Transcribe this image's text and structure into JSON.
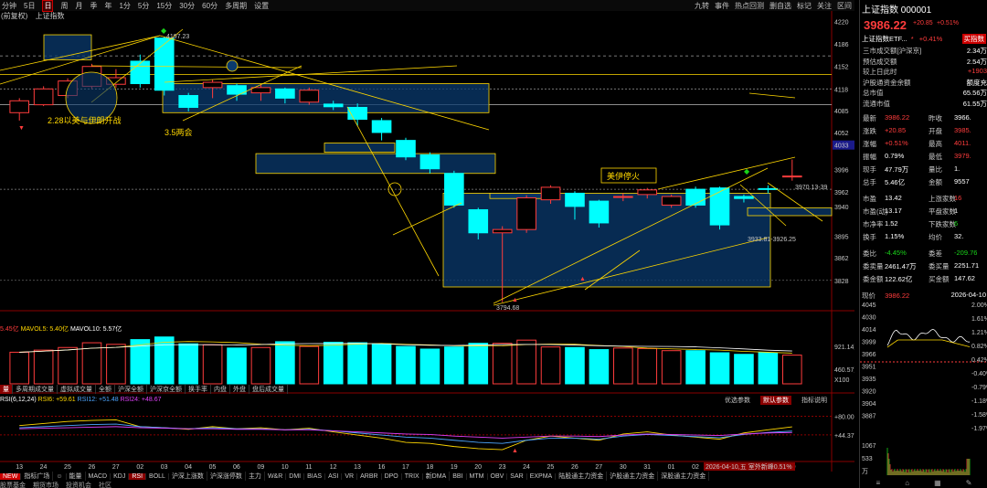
{
  "toolbar": {
    "left_items": [
      "分钟",
      "5日",
      "日",
      "周",
      "月",
      "季",
      "年",
      "1分",
      "5分",
      "15分",
      "30分",
      "60分",
      "多周期",
      "设置"
    ],
    "active": "日",
    "right_items": [
      "九转",
      "事件",
      "热点回测",
      "删自选",
      "标记",
      "关注",
      "区间"
    ]
  },
  "subheader": {
    "fq": "(前复权)",
    "name": "上证指数"
  },
  "annotations": {
    "a1": "2.28以美与伊朗开战",
    "a2": "3.5两会",
    "a3": "美伊停火",
    "hi_label": "4197.23",
    "lo_label": "3794.68",
    "rng_label1": "3970.13-39",
    "rng_label2": "3933.81-3926.25"
  },
  "price_axis": {
    "ticks": [
      "4220",
      "4186",
      "4152",
      "4118",
      "4085",
      "4052",
      "4033",
      "3996",
      "3962",
      "3940",
      "3895",
      "3862",
      "3828"
    ],
    "highlight": "4033"
  },
  "volume": {
    "legend": {
      "a": "5.45亿",
      "b": "MAVOL5: 5.40亿",
      "c": "MAVOL10: 5.57亿"
    },
    "axis": [
      "921.14万",
      "460.57万",
      "X100"
    ]
  },
  "indicator_tabs": [
    "量",
    "多周期成交量",
    "虚拟成交量",
    "全额",
    "沪深全额",
    "沪深京全额",
    "换手率",
    "内盘",
    "外盘",
    "盘后成交量"
  ],
  "rsi": {
    "legend": {
      "a": "RSI(6,12,24)",
      "b": "RSI6: +59.61",
      "c": "RSI12: +51.48",
      "d": "RSI24: +48.67"
    },
    "buttons": [
      "优选参数",
      "默认参数",
      "指标说明"
    ],
    "axis": [
      "+80.00",
      "+44.37"
    ]
  },
  "date_axis": [
    "13",
    "24",
    "25",
    "26",
    "27",
    "02",
    "03",
    "04",
    "05",
    "06",
    "09",
    "10",
    "11",
    "12",
    "13",
    "16",
    "17",
    "18",
    "19",
    "20",
    "23",
    "24",
    "25",
    "26",
    "27",
    "30",
    "31",
    "01",
    "02",
    "07",
    "08",
    "09",
    "10"
  ],
  "date_label": "2026-04-10,五 室外新峰0.51%",
  "bottom_tabs": [
    "NEW",
    "指标广场",
    "☺",
    "能量",
    "MACD",
    "KDJ",
    "RSI",
    "BOLL",
    "沪深上涨数",
    "沪深涨停数",
    "主力",
    "W&R",
    "DMI",
    "BIAS",
    "ASI",
    "VR",
    "ARBR",
    "DPO",
    "TRIX",
    "新DMA",
    "BBI",
    "MTM",
    "OBV",
    "SAR",
    "EXPMA",
    "陆股通主力资金",
    "沪股通主力资金",
    "深股通主力资金"
  ],
  "bottom_active": "RSI",
  "bottom2": [
    "股票基金",
    "期货市场",
    "投资机会",
    "社区"
  ],
  "right_panel": {
    "title": "上证指数 000001",
    "price": "3986.22",
    "change": "+20.85",
    "pct": "+0.51%",
    "ad_label": "上证指数ETF...",
    "ad_pct": "+0.41%",
    "ad_btn": "买指数",
    "rows1": [
      {
        "l": "三市成交额[沪深京]",
        "r": "2.34万",
        "c": "wh"
      },
      {
        "l": "预估成交额",
        "r": "2.54万",
        "c": "wh"
      },
      {
        "l": "较上日此时",
        "r": "+1903",
        "c": "red"
      },
      {
        "l": "沪股通资金余额",
        "r": "额度充",
        "c": "wh"
      },
      {
        "l": "总市值",
        "r": "65.56万",
        "c": "wh"
      },
      {
        "l": "流通市值",
        "r": "61.55万",
        "c": "wh"
      }
    ],
    "quote": [
      {
        "a": "最新",
        "b": "3986.22",
        "bc": "red",
        "c": "昨收",
        "d": "3966.",
        "dc": "wh"
      },
      {
        "a": "涨跌",
        "b": "+20.85",
        "bc": "red",
        "c": "开盘",
        "d": "3985.",
        "dc": "red"
      },
      {
        "a": "涨幅",
        "b": "+0.51%",
        "bc": "red",
        "c": "最高",
        "d": "4011.",
        "dc": "red"
      },
      {
        "a": "振幅",
        "b": "0.79%",
        "bc": "wh",
        "c": "最低",
        "d": "3979.",
        "dc": "red"
      },
      {
        "a": "现手",
        "b": "47.79万",
        "bc": "wh",
        "c": "量比",
        "d": "1.",
        "dc": "wh"
      },
      {
        "a": "总手",
        "b": "5.46亿",
        "bc": "wh",
        "c": "金额",
        "d": "9557",
        "dc": "wh"
      },
      {
        "a": "市盈",
        "b": "13.42",
        "bc": "wh",
        "c": "上涨家数",
        "d": "16",
        "dc": "red"
      },
      {
        "a": "市盈(动)",
        "b": "13.17",
        "bc": "wh",
        "c": "平盘家数",
        "d": "1",
        "dc": "wh"
      },
      {
        "a": "市净率",
        "b": "1.52",
        "bc": "wh",
        "c": "下跌家数",
        "d": "6",
        "dc": "green"
      },
      {
        "a": "换手",
        "b": "1.15%",
        "bc": "wh",
        "c": "均价",
        "d": "32.",
        "dc": "wh"
      },
      {
        "a": "委比",
        "b": "-4.45%",
        "bc": "green",
        "c": "委差",
        "d": "-209.76",
        "dc": "green"
      },
      {
        "a": "委卖量",
        "b": "2461.47万",
        "bc": "wh",
        "c": "委买量",
        "d": "2251.71",
        "dc": "wh"
      },
      {
        "a": "委金额",
        "b": "122.62亿",
        "bc": "wh",
        "c": "买金额",
        "d": "147.62",
        "dc": "wh"
      }
    ],
    "mini": {
      "label": "现价",
      "price": "3986.22",
      "date": "2026-04-10",
      "axis_l": [
        "4045",
        "4030",
        "4014",
        "3999",
        "3966",
        "3951",
        "3935",
        "3920",
        "3904",
        "3887",
        "1067",
        "533",
        "万"
      ],
      "axis_r": [
        "2.00%",
        "1.61%",
        "1.21%",
        "0.82%",
        "0.42%",
        "-0.40%",
        "-0.79%",
        "-1.18%",
        "-1.58%",
        "-1.97%"
      ]
    },
    "bottom_icons": [
      "≡",
      "⌂",
      "▦",
      "✎"
    ]
  },
  "colors": {
    "up": "#ff3c3c",
    "down": "#00ffff",
    "yellow": "#ffd700",
    "bg": "#000000",
    "box_fill": "#0a3a6e",
    "green": "#19d419"
  },
  "chart_data": [
    {
      "type": "candlestick",
      "title": "上证指数",
      "x": [
        "02-13",
        "02-24",
        "02-25",
        "02-26",
        "02-27",
        "03-02",
        "03-03",
        "03-04",
        "03-05",
        "03-06",
        "03-09",
        "03-10",
        "03-11",
        "03-12",
        "03-13",
        "03-16",
        "03-17",
        "03-18",
        "03-19",
        "03-20",
        "03-23",
        "03-24",
        "03-25",
        "03-26",
        "03-27",
        "03-30",
        "03-31",
        "04-01",
        "04-02",
        "04-07",
        "04-08",
        "04-09",
        "04-10"
      ],
      "open": [
        4082,
        4094,
        4108,
        4122,
        4125,
        4160,
        4195,
        4108,
        4120,
        4123,
        4112,
        4118,
        4098,
        4095,
        4090,
        4070,
        4040,
        4018,
        3990,
        3935,
        3900,
        3905,
        3950,
        3960,
        3948,
        3955,
        3958,
        3942,
        3966,
        3968,
        3955,
        3967,
        3985
      ],
      "close": [
        4100,
        4118,
        4130,
        4152,
        4135,
        4126,
        4116,
        4090,
        4128,
        4110,
        4120,
        4104,
        4116,
        4091,
        4072,
        4052,
        4015,
        3997,
        3942,
        3900,
        3905,
        3953,
        3969,
        3940,
        3915,
        3955,
        3965,
        3955,
        3942,
        3912,
        3952,
        3966,
        3986
      ],
      "high": [
        4104,
        4122,
        4134,
        4156,
        4148,
        4170,
        4197,
        4112,
        4132,
        4126,
        4124,
        4120,
        4120,
        4100,
        4096,
        4074,
        4044,
        4022,
        3994,
        3938,
        3910,
        3957,
        3972,
        3963,
        3950,
        3960,
        3968,
        3958,
        3970,
        3970,
        3958,
        3972,
        4011
      ],
      "low": [
        4070,
        4092,
        4104,
        4118,
        4120,
        4120,
        4108,
        4084,
        4104,
        4100,
        4100,
        4096,
        4094,
        4086,
        4062,
        4040,
        4010,
        3990,
        3938,
        3890,
        3795,
        3900,
        3944,
        3920,
        3908,
        3948,
        3952,
        3938,
        3938,
        3905,
        3946,
        3960,
        3979
      ],
      "ylim": [
        3800,
        4225
      ]
    },
    {
      "type": "bar",
      "title": "成交量",
      "x": [
        "02-13",
        "02-24",
        "02-25",
        "02-26",
        "02-27",
        "03-02",
        "03-03",
        "03-04",
        "03-05",
        "03-06",
        "03-09",
        "03-10",
        "03-11",
        "03-12",
        "03-13",
        "03-16",
        "03-17",
        "03-18",
        "03-19",
        "03-20",
        "03-23",
        "03-24",
        "03-25",
        "03-26",
        "03-27",
        "03-30",
        "03-31",
        "04-01",
        "04-02",
        "04-07",
        "04-08",
        "04-09",
        "04-10"
      ],
      "values": [
        6.0,
        6.4,
        6.9,
        7.8,
        7.5,
        8.4,
        8.9,
        7.6,
        7.4,
        6.8,
        6.9,
        8.0,
        7.1,
        7.9,
        7.8,
        7.6,
        7.1,
        6.6,
        7.0,
        7.7,
        7.7,
        8.3,
        7.0,
        6.9,
        6.5,
        6.8,
        6.7,
        6.3,
        6.3,
        5.9,
        5.6,
        5.9,
        5.45
      ],
      "ylim": [
        0,
        9.2
      ]
    },
    {
      "type": "line",
      "title": "RSI",
      "x": [
        "02-13",
        "02-24",
        "02-25",
        "02-26",
        "02-27",
        "03-02",
        "03-03",
        "03-04",
        "03-05",
        "03-06",
        "03-09",
        "03-10",
        "03-11",
        "03-12",
        "03-13",
        "03-16",
        "03-17",
        "03-18",
        "03-19",
        "03-20",
        "03-23",
        "03-24",
        "03-25",
        "03-26",
        "03-27",
        "03-30",
        "03-31",
        "04-01",
        "04-02",
        "04-07",
        "04-08",
        "04-09",
        "04-10"
      ],
      "series": [
        {
          "name": "RSI6",
          "values": [
            62,
            66,
            70,
            72,
            73,
            60,
            58,
            55,
            60,
            56,
            58,
            54,
            57,
            50,
            44,
            38,
            30,
            28,
            22,
            18,
            16,
            34,
            42,
            38,
            34,
            46,
            50,
            44,
            40,
            36,
            48,
            54,
            59.61
          ]
        },
        {
          "name": "RSI12",
          "values": [
            58,
            60,
            62,
            64,
            65,
            60,
            58,
            56,
            58,
            56,
            56,
            54,
            55,
            52,
            48,
            44,
            40,
            38,
            34,
            30,
            28,
            34,
            38,
            38,
            36,
            42,
            45,
            43,
            41,
            39,
            45,
            49,
            51.48
          ]
        },
        {
          "name": "RSI24",
          "values": [
            56,
            57,
            58,
            59,
            60,
            58,
            57,
            56,
            56,
            55,
            55,
            54,
            54,
            52,
            50,
            48,
            46,
            45,
            42,
            40,
            38,
            40,
            42,
            42,
            41,
            44,
            46,
            45,
            44,
            43,
            46,
            48,
            48.67
          ]
        }
      ],
      "ylim": [
        0,
        100
      ]
    }
  ]
}
